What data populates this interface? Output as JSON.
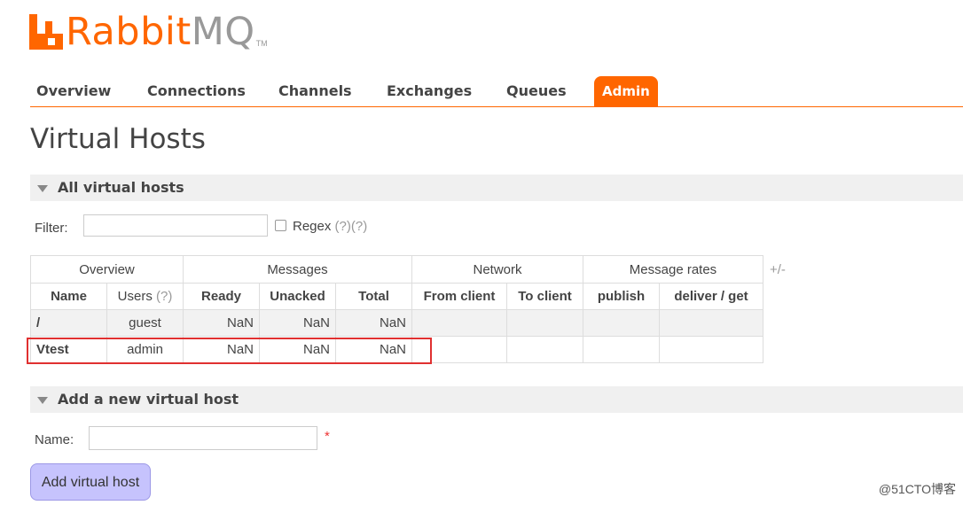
{
  "logo": {
    "part1": "Rabbit",
    "part2": "MQ",
    "tm": "TM"
  },
  "nav": {
    "tabs": [
      {
        "label": "Overview"
      },
      {
        "label": "Connections"
      },
      {
        "label": "Channels"
      },
      {
        "label": "Exchanges"
      },
      {
        "label": "Queues"
      },
      {
        "label": "Admin",
        "active": true
      }
    ]
  },
  "page": {
    "title": "Virtual Hosts"
  },
  "all_vhosts": {
    "header": "All virtual hosts",
    "filter_label": "Filter:",
    "filter_value": "",
    "regex_label": "Regex",
    "regex_help": "(?)(?)",
    "toggle_columns": "+/-",
    "table": {
      "groups": [
        "Overview",
        "Messages",
        "Network",
        "Message rates"
      ],
      "columns": {
        "name": "Name",
        "users": "Users",
        "users_help": "(?)",
        "ready": "Ready",
        "unacked": "Unacked",
        "total": "Total",
        "from_client": "From client",
        "to_client": "To client",
        "publish": "publish",
        "deliver_get": "deliver / get"
      },
      "rows": [
        {
          "name": "/",
          "users": "guest",
          "ready": "NaN",
          "unacked": "NaN",
          "total": "NaN",
          "from_client": "",
          "to_client": "",
          "publish": "",
          "deliver_get": ""
        },
        {
          "name": "Vtest",
          "users": "admin",
          "ready": "NaN",
          "unacked": "NaN",
          "total": "NaN",
          "from_client": "",
          "to_client": "",
          "publish": "",
          "deliver_get": ""
        }
      ]
    }
  },
  "add_vhost": {
    "header": "Add a new virtual host",
    "name_label": "Name:",
    "name_value": "",
    "required_mark": "*",
    "button_label": "Add virtual host"
  },
  "watermark": "@51CTO博客",
  "colors": {
    "accent": "#ff6600",
    "button_bg": "#c6c3fd",
    "highlight_border": "#e03030"
  }
}
